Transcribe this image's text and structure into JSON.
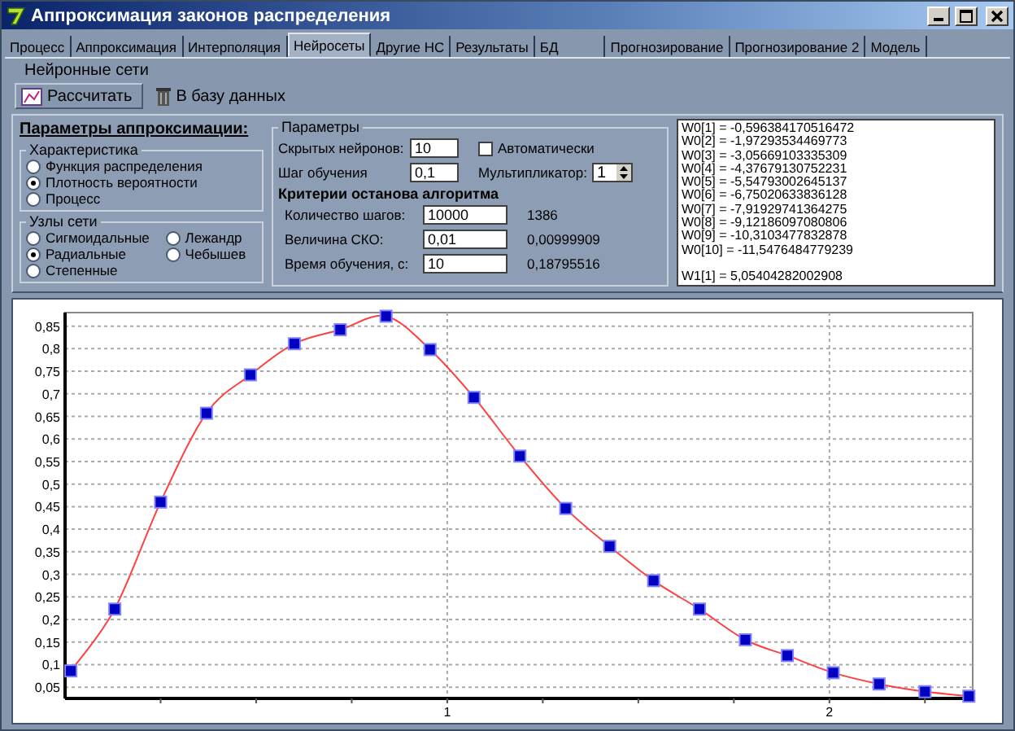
{
  "window": {
    "title": "Аппроксимация законов распределения"
  },
  "tabs": [
    {
      "label": "Процесс",
      "selected": false
    },
    {
      "label": "Аппроксимация",
      "selected": false
    },
    {
      "label": "Интерполяция",
      "selected": false
    },
    {
      "label": "Нейросеты",
      "selected": true
    },
    {
      "label": "Другие НС",
      "selected": false
    },
    {
      "label": "Результаты",
      "selected": false
    },
    {
      "label": "БД",
      "selected": false
    },
    {
      "label": "Прогнозирование",
      "selected": false
    },
    {
      "label": "Прогнозирование 2",
      "selected": false
    },
    {
      "label": "Модель",
      "selected": false
    }
  ],
  "toolbar": {
    "title": "Нейронные сети",
    "buttons": [
      {
        "label": "Рассчитать",
        "kind": "chart"
      },
      {
        "label": "В базу данных",
        "kind": "bin"
      }
    ]
  },
  "approximation": {
    "heading": "Параметры аппроксимации:",
    "characteristic": {
      "title": "Характеристика",
      "options": [
        {
          "label": "Функция распределения",
          "selected": false
        },
        {
          "label": "Плотность вероятности",
          "selected": true
        },
        {
          "label": "Процесс",
          "selected": false
        }
      ]
    },
    "nodes": {
      "title": "Узлы сети",
      "options": [
        {
          "label": "Сигмоидальные",
          "selected": false
        },
        {
          "label": "Лежандр",
          "selected": false
        },
        {
          "label": "Радиальные",
          "selected": true
        },
        {
          "label": "Чебышев",
          "selected": false
        },
        {
          "label": "Степенные",
          "selected": false
        }
      ]
    }
  },
  "parameters": {
    "title": "Параметры",
    "hidden_neurons": {
      "label": "Скрытых нейронов:",
      "value": "10"
    },
    "auto": {
      "label": "Автоматически",
      "checked": false
    },
    "learning_step": {
      "label": "Шаг обучения",
      "value": "0,1"
    },
    "multiplier": {
      "label": "Мультипликатор:",
      "value": "1"
    },
    "criteria_title": "Критерии останова алгоритма",
    "criteria": [
      {
        "label": "Количество шагов:",
        "value": "10000",
        "result": "1386"
      },
      {
        "label": "Величина СКО:",
        "value": "0,01",
        "result": "0,00999909"
      },
      {
        "label": "Время обучения, с:",
        "value": "10",
        "result": "0,18795516"
      }
    ]
  },
  "weights": [
    {
      "lines": [
        "W0[1] = -0,596384170516472",
        "W0[2] = -1,97293534469773",
        "W0[3] = -3,05669103335309",
        "W0[4] = -4,37679130752231",
        "W0[5] = -5,54793002645137",
        "W0[6] = -6,75020633836128",
        "W0[7] = -7,91929741364275",
        "W0[8] = -9,12186097080806",
        "W0[9] = -10,3103477832878",
        "W0[10] = -11,5476484779239"
      ]
    },
    {
      "lines": [
        "W1[1] = 5,05404282002908"
      ]
    }
  ],
  "plot": {
    "chart_data": {
      "type": "line",
      "x": [
        0.015,
        0.13,
        0.25,
        0.37,
        0.485,
        0.6,
        0.72,
        0.84,
        0.955,
        1.07,
        1.19,
        1.31,
        1.425,
        1.54,
        1.66,
        1.78,
        1.89,
        2.01,
        2.13,
        2.25,
        2.365
      ],
      "series": [
        {
          "color": "#ff4040",
          "marker": "square",
          "values": [
            0.086,
            0.223,
            0.46,
            0.657,
            0.742,
            0.811,
            0.842,
            0.872,
            0.798,
            0.692,
            0.562,
            0.446,
            0.362,
            0.286,
            0.223,
            0.155,
            0.12,
            0.082,
            0.057,
            0.04,
            0.03
          ]
        }
      ],
      "grid": true,
      "xlim": [
        0,
        2.375
      ],
      "ylim": [
        0.025,
        0.88
      ],
      "xticks": [
        1,
        2
      ],
      "yticks": [
        {
          "value": 0.05,
          "label": "0,05"
        },
        {
          "value": 0.1,
          "label": "0,1"
        },
        {
          "value": 0.15,
          "label": "0,15"
        },
        {
          "value": 0.2,
          "label": "0,2"
        },
        {
          "value": 0.25,
          "label": "0,25"
        },
        {
          "value": 0.3,
          "label": "0,3"
        },
        {
          "value": 0.35,
          "label": "0,35"
        },
        {
          "value": 0.4,
          "label": "0,4"
        },
        {
          "value": 0.45,
          "label": "0,45"
        },
        {
          "value": 0.5,
          "label": "0,5"
        },
        {
          "value": 0.55,
          "label": "0,55"
        },
        {
          "value": 0.6,
          "label": "0,6"
        },
        {
          "value": 0.65,
          "label": "0,65"
        },
        {
          "value": 0.7,
          "label": "0,7"
        },
        {
          "value": 0.75,
          "label": "0,75"
        },
        {
          "value": 0.8,
          "label": "0,8"
        },
        {
          "value": 0.85,
          "label": "0,85"
        }
      ]
    }
  }
}
